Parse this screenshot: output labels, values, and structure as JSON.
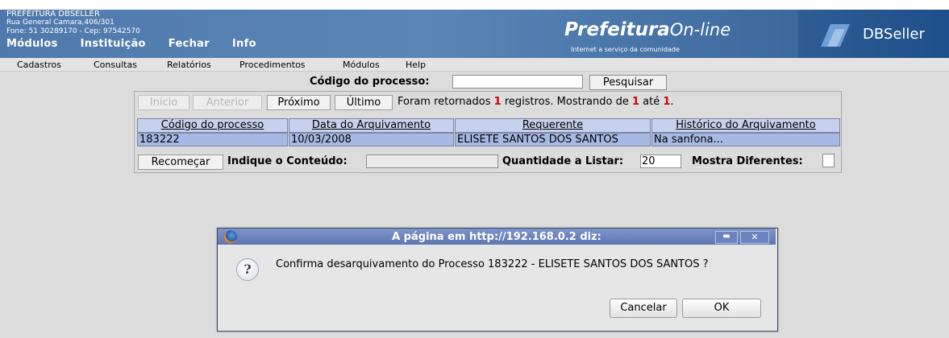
{
  "header": {
    "org_name": "PREFEITURA DBSELLER",
    "org_address": "Rua General Camara,406/301",
    "org_phone": "Fone: 51 30289170  -  Cep: 97542570",
    "nav": [
      "Módulos",
      "Instituição",
      "Fechar",
      "Info"
    ],
    "brand_main": "Prefeitura",
    "brand_online": "On-line",
    "brand_tagline": "Internet a serviço da comunidade",
    "vendor": "DBSeller"
  },
  "menubar": [
    "Cadastros",
    "Consultas",
    "Relatórios",
    "Procedimentos",
    "Módulos",
    "Help"
  ],
  "search": {
    "label": "Código do processo:",
    "value": "",
    "button": "Pesquisar"
  },
  "pager": {
    "inicio": "Início",
    "anterior": "Anterior",
    "proximo": "Próximo",
    "ultimo": "Último",
    "msg_prefix": "Foram retornados",
    "count": "1",
    "msg_mid": "registros. Mostrando de",
    "from": "1",
    "msg_ate": "até",
    "to": "1",
    "msg_end": "."
  },
  "table": {
    "columns": [
      "Código do processo",
      "Data do Arquivamento",
      "Requerente",
      "Histórico do Arquivamento"
    ],
    "rows": [
      [
        "183222",
        "10/03/2008",
        "ELISETE SANTOS DOS SANTOS",
        "Na sanfona..."
      ]
    ]
  },
  "controls": {
    "recomecar": "Recomeçar",
    "indique_label": "Indique o Conteúdo:",
    "quantidade_label": "Quantidade a Listar:",
    "quantidade_value": "20",
    "mostra_label": "Mostra Diferentes:"
  },
  "dialog": {
    "title": "A página em http://192.168.0.2 diz:",
    "message": "Confirma desarquivamento do Processo 183222 - ELISETE SANTOS DOS SANTOS ?",
    "cancel": "Cancelar",
    "ok": "OK",
    "max_glyph": "▬",
    "close_glyph": "✕",
    "icon": "?"
  },
  "colors": {
    "header": "#5a86b7",
    "table_header": "#c7d1ed",
    "table_row": "#a7b9e3",
    "dialog_title": "#5f76b1",
    "count_red": "#d20000"
  }
}
